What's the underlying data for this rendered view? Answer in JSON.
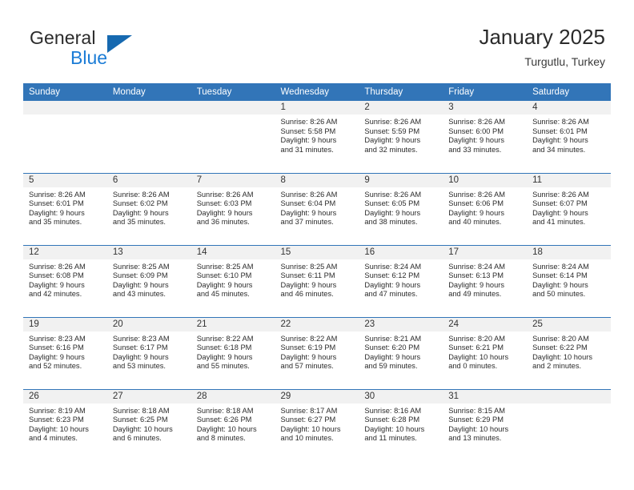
{
  "brand": {
    "line1": "General",
    "line2": "Blue",
    "triangle_color": "#1669b0",
    "blue_text_color": "#1b7cd6"
  },
  "header": {
    "title": "January 2025",
    "subtitle": "Turgutlu, Turkey"
  },
  "theme": {
    "header_row_bg": "#3275b8",
    "daynum_bg": "#f1f1f1",
    "cell_bg": "#ffffff",
    "text_color": "#2b2b2b"
  },
  "calendar": {
    "weekday_headers": [
      "Sunday",
      "Monday",
      "Tuesday",
      "Wednesday",
      "Thursday",
      "Friday",
      "Saturday"
    ],
    "weeks": [
      [
        {
          "day": "",
          "empty": true,
          "sunrise": "",
          "sunset": "",
          "daylight1": "",
          "daylight2": ""
        },
        {
          "day": "",
          "empty": true,
          "sunrise": "",
          "sunset": "",
          "daylight1": "",
          "daylight2": ""
        },
        {
          "day": "",
          "empty": true,
          "sunrise": "",
          "sunset": "",
          "daylight1": "",
          "daylight2": ""
        },
        {
          "day": "1",
          "empty": false,
          "sunrise": "Sunrise: 8:26 AM",
          "sunset": "Sunset: 5:58 PM",
          "daylight1": "Daylight: 9 hours",
          "daylight2": "and 31 minutes."
        },
        {
          "day": "2",
          "empty": false,
          "sunrise": "Sunrise: 8:26 AM",
          "sunset": "Sunset: 5:59 PM",
          "daylight1": "Daylight: 9 hours",
          "daylight2": "and 32 minutes."
        },
        {
          "day": "3",
          "empty": false,
          "sunrise": "Sunrise: 8:26 AM",
          "sunset": "Sunset: 6:00 PM",
          "daylight1": "Daylight: 9 hours",
          "daylight2": "and 33 minutes."
        },
        {
          "day": "4",
          "empty": false,
          "sunrise": "Sunrise: 8:26 AM",
          "sunset": "Sunset: 6:01 PM",
          "daylight1": "Daylight: 9 hours",
          "daylight2": "and 34 minutes."
        }
      ],
      [
        {
          "day": "5",
          "empty": false,
          "sunrise": "Sunrise: 8:26 AM",
          "sunset": "Sunset: 6:01 PM",
          "daylight1": "Daylight: 9 hours",
          "daylight2": "and 35 minutes."
        },
        {
          "day": "6",
          "empty": false,
          "sunrise": "Sunrise: 8:26 AM",
          "sunset": "Sunset: 6:02 PM",
          "daylight1": "Daylight: 9 hours",
          "daylight2": "and 35 minutes."
        },
        {
          "day": "7",
          "empty": false,
          "sunrise": "Sunrise: 8:26 AM",
          "sunset": "Sunset: 6:03 PM",
          "daylight1": "Daylight: 9 hours",
          "daylight2": "and 36 minutes."
        },
        {
          "day": "8",
          "empty": false,
          "sunrise": "Sunrise: 8:26 AM",
          "sunset": "Sunset: 6:04 PM",
          "daylight1": "Daylight: 9 hours",
          "daylight2": "and 37 minutes."
        },
        {
          "day": "9",
          "empty": false,
          "sunrise": "Sunrise: 8:26 AM",
          "sunset": "Sunset: 6:05 PM",
          "daylight1": "Daylight: 9 hours",
          "daylight2": "and 38 minutes."
        },
        {
          "day": "10",
          "empty": false,
          "sunrise": "Sunrise: 8:26 AM",
          "sunset": "Sunset: 6:06 PM",
          "daylight1": "Daylight: 9 hours",
          "daylight2": "and 40 minutes."
        },
        {
          "day": "11",
          "empty": false,
          "sunrise": "Sunrise: 8:26 AM",
          "sunset": "Sunset: 6:07 PM",
          "daylight1": "Daylight: 9 hours",
          "daylight2": "and 41 minutes."
        }
      ],
      [
        {
          "day": "12",
          "empty": false,
          "sunrise": "Sunrise: 8:26 AM",
          "sunset": "Sunset: 6:08 PM",
          "daylight1": "Daylight: 9 hours",
          "daylight2": "and 42 minutes."
        },
        {
          "day": "13",
          "empty": false,
          "sunrise": "Sunrise: 8:25 AM",
          "sunset": "Sunset: 6:09 PM",
          "daylight1": "Daylight: 9 hours",
          "daylight2": "and 43 minutes."
        },
        {
          "day": "14",
          "empty": false,
          "sunrise": "Sunrise: 8:25 AM",
          "sunset": "Sunset: 6:10 PM",
          "daylight1": "Daylight: 9 hours",
          "daylight2": "and 45 minutes."
        },
        {
          "day": "15",
          "empty": false,
          "sunrise": "Sunrise: 8:25 AM",
          "sunset": "Sunset: 6:11 PM",
          "daylight1": "Daylight: 9 hours",
          "daylight2": "and 46 minutes."
        },
        {
          "day": "16",
          "empty": false,
          "sunrise": "Sunrise: 8:24 AM",
          "sunset": "Sunset: 6:12 PM",
          "daylight1": "Daylight: 9 hours",
          "daylight2": "and 47 minutes."
        },
        {
          "day": "17",
          "empty": false,
          "sunrise": "Sunrise: 8:24 AM",
          "sunset": "Sunset: 6:13 PM",
          "daylight1": "Daylight: 9 hours",
          "daylight2": "and 49 minutes."
        },
        {
          "day": "18",
          "empty": false,
          "sunrise": "Sunrise: 8:24 AM",
          "sunset": "Sunset: 6:14 PM",
          "daylight1": "Daylight: 9 hours",
          "daylight2": "and 50 minutes."
        }
      ],
      [
        {
          "day": "19",
          "empty": false,
          "sunrise": "Sunrise: 8:23 AM",
          "sunset": "Sunset: 6:16 PM",
          "daylight1": "Daylight: 9 hours",
          "daylight2": "and 52 minutes."
        },
        {
          "day": "20",
          "empty": false,
          "sunrise": "Sunrise: 8:23 AM",
          "sunset": "Sunset: 6:17 PM",
          "daylight1": "Daylight: 9 hours",
          "daylight2": "and 53 minutes."
        },
        {
          "day": "21",
          "empty": false,
          "sunrise": "Sunrise: 8:22 AM",
          "sunset": "Sunset: 6:18 PM",
          "daylight1": "Daylight: 9 hours",
          "daylight2": "and 55 minutes."
        },
        {
          "day": "22",
          "empty": false,
          "sunrise": "Sunrise: 8:22 AM",
          "sunset": "Sunset: 6:19 PM",
          "daylight1": "Daylight: 9 hours",
          "daylight2": "and 57 minutes."
        },
        {
          "day": "23",
          "empty": false,
          "sunrise": "Sunrise: 8:21 AM",
          "sunset": "Sunset: 6:20 PM",
          "daylight1": "Daylight: 9 hours",
          "daylight2": "and 59 minutes."
        },
        {
          "day": "24",
          "empty": false,
          "sunrise": "Sunrise: 8:20 AM",
          "sunset": "Sunset: 6:21 PM",
          "daylight1": "Daylight: 10 hours",
          "daylight2": "and 0 minutes."
        },
        {
          "day": "25",
          "empty": false,
          "sunrise": "Sunrise: 8:20 AM",
          "sunset": "Sunset: 6:22 PM",
          "daylight1": "Daylight: 10 hours",
          "daylight2": "and 2 minutes."
        }
      ],
      [
        {
          "day": "26",
          "empty": false,
          "sunrise": "Sunrise: 8:19 AM",
          "sunset": "Sunset: 6:23 PM",
          "daylight1": "Daylight: 10 hours",
          "daylight2": "and 4 minutes."
        },
        {
          "day": "27",
          "empty": false,
          "sunrise": "Sunrise: 8:18 AM",
          "sunset": "Sunset: 6:25 PM",
          "daylight1": "Daylight: 10 hours",
          "daylight2": "and 6 minutes."
        },
        {
          "day": "28",
          "empty": false,
          "sunrise": "Sunrise: 8:18 AM",
          "sunset": "Sunset: 6:26 PM",
          "daylight1": "Daylight: 10 hours",
          "daylight2": "and 8 minutes."
        },
        {
          "day": "29",
          "empty": false,
          "sunrise": "Sunrise: 8:17 AM",
          "sunset": "Sunset: 6:27 PM",
          "daylight1": "Daylight: 10 hours",
          "daylight2": "and 10 minutes."
        },
        {
          "day": "30",
          "empty": false,
          "sunrise": "Sunrise: 8:16 AM",
          "sunset": "Sunset: 6:28 PM",
          "daylight1": "Daylight: 10 hours",
          "daylight2": "and 11 minutes."
        },
        {
          "day": "31",
          "empty": false,
          "sunrise": "Sunrise: 8:15 AM",
          "sunset": "Sunset: 6:29 PM",
          "daylight1": "Daylight: 10 hours",
          "daylight2": "and 13 minutes."
        },
        {
          "day": "",
          "empty": true,
          "sunrise": "",
          "sunset": "",
          "daylight1": "",
          "daylight2": ""
        }
      ]
    ]
  }
}
